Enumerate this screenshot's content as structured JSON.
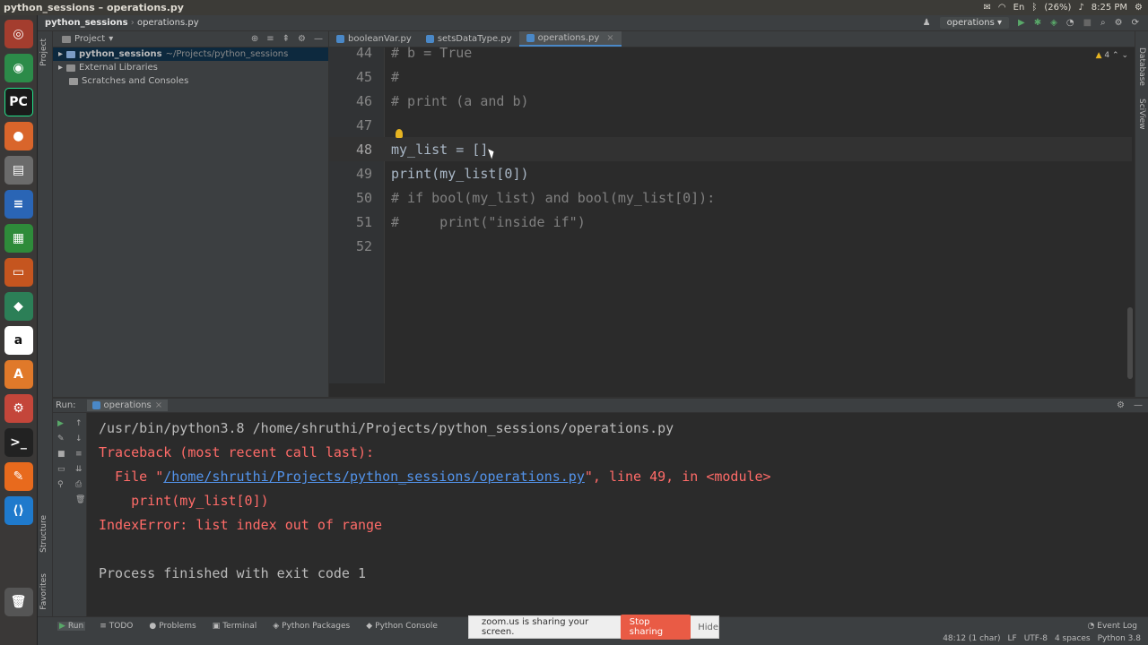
{
  "topbar": {
    "title": "python_sessions – operations.py",
    "battery": "(26%)",
    "clock": "8:25 PM",
    "lang": "En"
  },
  "navbar": {
    "project": "python_sessions",
    "file": "operations.py",
    "run_config": "operations"
  },
  "project_panel": {
    "title": "Project",
    "items": [
      {
        "label": "python_sessions",
        "path": "~/Projects/python_sessions"
      },
      {
        "label": "External Libraries",
        "path": ""
      },
      {
        "label": "Scratches and Consoles",
        "path": ""
      }
    ]
  },
  "editor_tabs": [
    "booleanVar.py",
    "setsDataType.py",
    "operations.py"
  ],
  "editor": {
    "inspection_count": "4",
    "lines": [
      {
        "num": "44",
        "text": "# b = True"
      },
      {
        "num": "45",
        "text": "#"
      },
      {
        "num": "46",
        "text": "# print (a and b)"
      },
      {
        "num": "47",
        "text": ""
      },
      {
        "num": "48",
        "text": "my_list = []"
      },
      {
        "num": "49",
        "text": "print(my_list[0])"
      },
      {
        "num": "50",
        "text": "# if bool(my_list) and bool(my_list[0]):"
      },
      {
        "num": "51",
        "text": "#     print(\"inside if\")"
      },
      {
        "num": "52",
        "text": ""
      }
    ]
  },
  "run_panel": {
    "label": "Run:",
    "tab": "operations",
    "console": {
      "cmd": "/usr/bin/python3.8 /home/shruthi/Projects/python_sessions/operations.py",
      "traceback": "Traceback (most recent call last):",
      "file_prefix": "  File \"",
      "file_path": "/home/shruthi/Projects/python_sessions/operations.py",
      "file_suffix": "\", line 49, in <module>",
      "code": "    print(my_list[0])",
      "error": "IndexError: list index out of range",
      "exit": "Process finished with exit code 1"
    }
  },
  "statusbar": {
    "tabs": [
      "Run",
      "TODO",
      "Problems",
      "Terminal",
      "Python Packages",
      "Python Console"
    ],
    "event_log": "Event Log",
    "position": "48:12 (1 char)",
    "line_sep": "LF",
    "encoding": "UTF-8",
    "indent": "4 spaces",
    "interpreter": "Python 3.8"
  },
  "zoom_bar": {
    "text": "zoom.us is sharing your screen.",
    "stop": "Stop sharing",
    "hide": "Hide"
  },
  "left_tool_tabs": {
    "project": "Project",
    "structure": "Structure",
    "favorites": "Favorites"
  },
  "right_tool_tabs": {
    "database": "Database",
    "sciview": "SciView"
  }
}
